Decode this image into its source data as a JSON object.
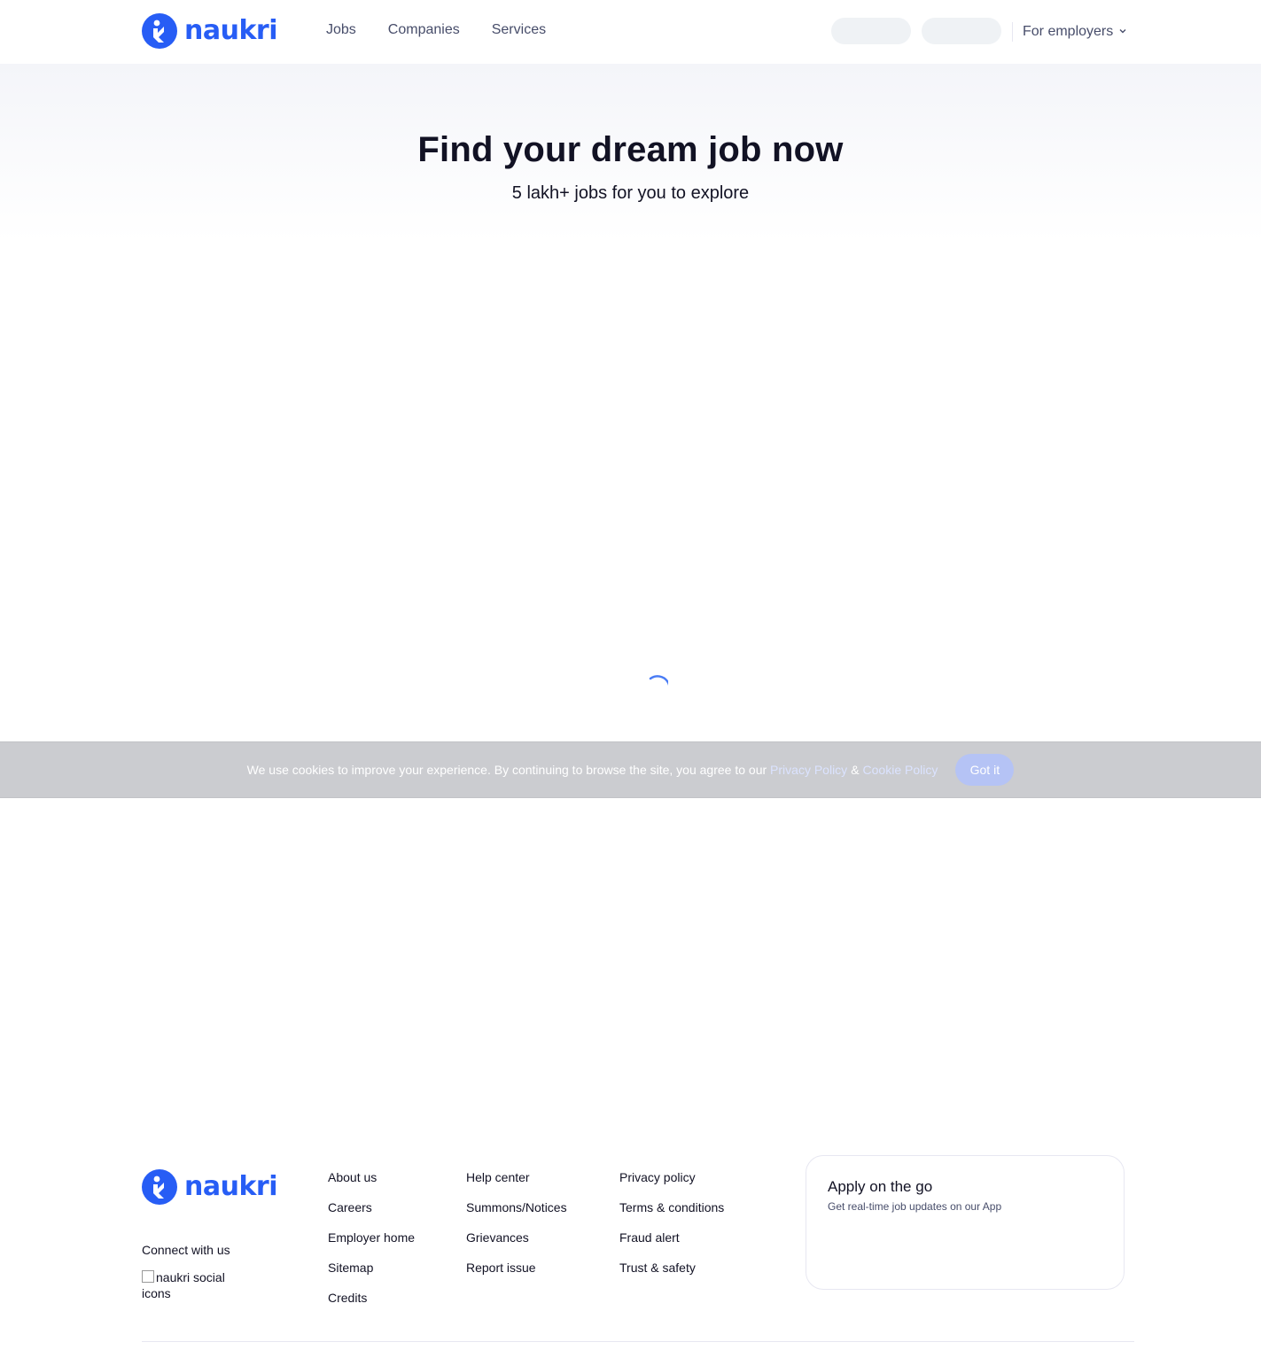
{
  "brand": {
    "name": "naukri",
    "color": "#275df5"
  },
  "header": {
    "nav": [
      {
        "label": "Jobs"
      },
      {
        "label": "Companies"
      },
      {
        "label": "Services"
      }
    ],
    "employers_label": "For employers"
  },
  "hero": {
    "title": "Find your dream job now",
    "subtitle": "5 lakh+ jobs for you to explore"
  },
  "cookie": {
    "text": "We use cookies to improve your experience. By continuing to browse the site, you agree to our",
    "privacy_link": "Privacy Policy",
    "amp": "&",
    "cookie_link": "Cookie Policy",
    "button": "Got it"
  },
  "footer": {
    "connect": "Connect with us",
    "social_alt": "naukri social icons",
    "col1": [
      "About us",
      "Careers",
      "Employer home",
      "Sitemap",
      "Credits"
    ],
    "col2": [
      "Help center",
      "Summons/Notices",
      "Grievances",
      "Report issue"
    ],
    "col3": [
      "Privacy policy",
      "Terms & conditions",
      "Fraud alert",
      "Trust & safety"
    ],
    "apply": {
      "title": "Apply on the go",
      "subtitle": "Get real-time job updates on our App"
    }
  }
}
